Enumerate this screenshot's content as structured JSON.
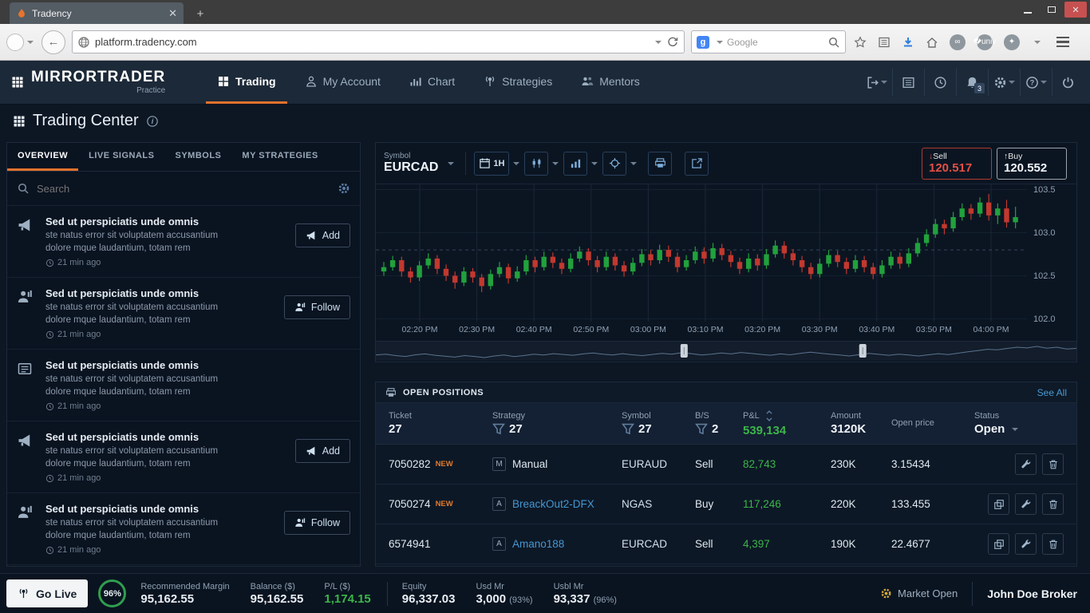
{
  "colors": {
    "accent_orange": "#e0722d",
    "green": "#3cb54a",
    "red": "#d9453a",
    "link_blue": "#4a9ad4",
    "candle_up": "#21a13c",
    "candle_down": "#c2382e"
  },
  "browser": {
    "tab_title": "Tradency",
    "url": "platform.tradency.com",
    "search_engine": "Google"
  },
  "app_header": {
    "logo": "MIRRORTRADER",
    "logo_sub": "Practice",
    "nav": [
      {
        "label": "Trading",
        "icon": "grid",
        "active": true
      },
      {
        "label": "My Account",
        "icon": "person",
        "active": false
      },
      {
        "label": "Chart",
        "icon": "chartbars",
        "active": false
      },
      {
        "label": "Strategies",
        "icon": "antenna",
        "active": false
      },
      {
        "label": "Mentors",
        "icon": "persons",
        "active": false
      }
    ],
    "notification_count": "3"
  },
  "page": {
    "title": "Trading Center"
  },
  "sidebar": {
    "tabs": [
      {
        "label": "OVERVIEW",
        "active": true
      },
      {
        "label": "LIVE SIGNALS",
        "active": false
      },
      {
        "label": "SYMBOLS",
        "active": false
      },
      {
        "label": "MY STRATEGIES",
        "active": false
      }
    ],
    "search_placeholder": "Search",
    "cards": [
      {
        "icon": "megaphone",
        "title": "Sed ut perspiciatis unde omnis",
        "desc": "ste natus error sit voluptatem accusantium dolore mque laudantium, totam rem",
        "time": "21 min ago",
        "action": "Add",
        "action_icon": "megaphone"
      },
      {
        "icon": "personchart",
        "title": "Sed ut perspiciatis unde omnis",
        "desc": "ste natus error sit voluptatem accusantium dolore mque laudantium, totam rem",
        "time": "21 min ago",
        "action": "Follow",
        "action_icon": "personchart"
      },
      {
        "icon": "news",
        "title": "Sed ut perspiciatis unde omnis",
        "desc": "ste natus error sit voluptatem accusantium dolore mque laudantium, totam rem",
        "time": "21 min ago",
        "action": "",
        "action_icon": ""
      },
      {
        "icon": "megaphone",
        "title": "Sed ut perspiciatis unde omnis",
        "desc": "ste natus error sit voluptatem accusantium dolore mque laudantium, totam rem",
        "time": "21 min ago",
        "action": "Add",
        "action_icon": "megaphone"
      },
      {
        "icon": "personchart",
        "title": "Sed ut perspiciatis unde omnis",
        "desc": "ste natus error sit voluptatem accusantium dolore mque laudantium, totam rem",
        "time": "21 min ago",
        "action": "Follow",
        "action_icon": "personchart"
      }
    ]
  },
  "chart": {
    "symbol_label": "Symbol",
    "symbol": "EURCAD",
    "timeframe": "1H",
    "sell_label": "Sell",
    "sell_price": "120.517",
    "buy_label": "Buy",
    "buy_price": "120.552"
  },
  "chart_data": {
    "type": "candlestick",
    "title": "EURCAD 1H intraday candles",
    "x_labels": [
      "02:20 PM",
      "02:30 PM",
      "02:40 PM",
      "02:50 PM",
      "03:00 PM",
      "03:10 PM",
      "03:20 PM",
      "03:30 PM",
      "03:40 PM",
      "03:50 PM",
      "04:00 PM"
    ],
    "y_ticks": [
      103.5,
      103.0,
      102.5,
      102.0
    ],
    "ylim": [
      101.8,
      103.6
    ],
    "dashed_level": 102.8,
    "up_color": "#21a13c",
    "down_color": "#c2382e",
    "candles": [
      [
        102.55,
        102.66,
        102.5,
        102.6
      ],
      [
        102.6,
        102.73,
        102.56,
        102.68
      ],
      [
        102.68,
        102.72,
        102.49,
        102.55
      ],
      [
        102.55,
        102.6,
        102.42,
        102.48
      ],
      [
        102.48,
        102.67,
        102.44,
        102.62
      ],
      [
        102.62,
        102.76,
        102.58,
        102.7
      ],
      [
        102.7,
        102.74,
        102.52,
        102.58
      ],
      [
        102.58,
        102.63,
        102.44,
        102.5
      ],
      [
        102.5,
        102.55,
        102.35,
        102.42
      ],
      [
        102.42,
        102.6,
        102.38,
        102.55
      ],
      [
        102.55,
        102.59,
        102.42,
        102.48
      ],
      [
        102.48,
        102.52,
        102.31,
        102.38
      ],
      [
        102.38,
        102.57,
        102.34,
        102.52
      ],
      [
        102.52,
        102.66,
        102.48,
        102.6
      ],
      [
        102.6,
        102.64,
        102.41,
        102.47
      ],
      [
        102.47,
        102.61,
        102.43,
        102.55
      ],
      [
        102.55,
        102.74,
        102.51,
        102.68
      ],
      [
        102.68,
        102.72,
        102.54,
        102.6
      ],
      [
        102.6,
        102.78,
        102.56,
        102.72
      ],
      [
        102.72,
        102.77,
        102.59,
        102.65
      ],
      [
        102.65,
        102.7,
        102.52,
        102.58
      ],
      [
        102.58,
        102.76,
        102.54,
        102.7
      ],
      [
        102.7,
        102.84,
        102.66,
        102.78
      ],
      [
        102.78,
        102.82,
        102.62,
        102.68
      ],
      [
        102.68,
        102.73,
        102.54,
        102.6
      ],
      [
        102.6,
        102.78,
        102.56,
        102.72
      ],
      [
        102.72,
        102.76,
        102.56,
        102.62
      ],
      [
        102.62,
        102.67,
        102.49,
        102.55
      ],
      [
        102.55,
        102.71,
        102.51,
        102.65
      ],
      [
        102.65,
        102.81,
        102.61,
        102.75
      ],
      [
        102.75,
        102.8,
        102.62,
        102.68
      ],
      [
        102.68,
        102.86,
        102.64,
        102.8
      ],
      [
        102.8,
        102.85,
        102.66,
        102.72
      ],
      [
        102.72,
        102.77,
        102.54,
        102.6
      ],
      [
        102.6,
        102.74,
        102.56,
        102.68
      ],
      [
        102.68,
        102.84,
        102.64,
        102.78
      ],
      [
        102.78,
        102.83,
        102.64,
        102.7
      ],
      [
        102.7,
        102.88,
        102.66,
        102.82
      ],
      [
        102.82,
        102.87,
        102.68,
        102.74
      ],
      [
        102.74,
        102.79,
        102.6,
        102.66
      ],
      [
        102.66,
        102.71,
        102.52,
        102.58
      ],
      [
        102.58,
        102.76,
        102.54,
        102.7
      ],
      [
        102.7,
        102.75,
        102.56,
        102.62
      ],
      [
        102.62,
        102.81,
        102.58,
        102.75
      ],
      [
        102.75,
        102.91,
        102.71,
        102.85
      ],
      [
        102.85,
        102.9,
        102.7,
        102.76
      ],
      [
        102.76,
        102.81,
        102.62,
        102.68
      ],
      [
        102.68,
        102.73,
        102.54,
        102.6
      ],
      [
        102.6,
        102.65,
        102.46,
        102.52
      ],
      [
        102.52,
        102.7,
        102.48,
        102.64
      ],
      [
        102.64,
        102.8,
        102.6,
        102.74
      ],
      [
        102.74,
        102.79,
        102.6,
        102.66
      ],
      [
        102.66,
        102.71,
        102.52,
        102.58
      ],
      [
        102.58,
        102.74,
        102.54,
        102.68
      ],
      [
        102.68,
        102.73,
        102.54,
        102.6
      ],
      [
        102.6,
        102.65,
        102.46,
        102.52
      ],
      [
        102.52,
        102.68,
        102.48,
        102.62
      ],
      [
        102.62,
        102.78,
        102.58,
        102.72
      ],
      [
        102.72,
        102.77,
        102.58,
        102.64
      ],
      [
        102.64,
        102.82,
        102.6,
        102.76
      ],
      [
        102.76,
        102.94,
        102.72,
        102.88
      ],
      [
        102.88,
        103.04,
        102.84,
        102.98
      ],
      [
        102.98,
        103.16,
        102.94,
        103.1
      ],
      [
        103.1,
        103.15,
        102.98,
        103.05
      ],
      [
        103.05,
        103.24,
        103.01,
        103.18
      ],
      [
        103.18,
        103.34,
        103.14,
        103.28
      ],
      [
        103.28,
        103.33,
        103.15,
        103.22
      ],
      [
        103.22,
        103.41,
        103.18,
        103.35
      ],
      [
        103.35,
        103.45,
        103.14,
        103.2
      ],
      [
        103.2,
        103.34,
        103.1,
        103.28
      ],
      [
        103.28,
        103.38,
        103.06,
        103.12
      ],
      [
        103.12,
        103.3,
        103.05,
        103.18
      ]
    ],
    "navigator_handles_pct": [
      0.44,
      0.695
    ]
  },
  "positions": {
    "title": "OPEN POSITIONS",
    "see_all": "See All",
    "new_label": "NEW",
    "columns": [
      {
        "label": "Ticket",
        "value": "27",
        "filter": false,
        "sort": false,
        "green": false,
        "dropdown": false
      },
      {
        "label": "Strategy",
        "value": "27",
        "filter": true,
        "sort": false,
        "green": false,
        "dropdown": false
      },
      {
        "label": "Symbol",
        "value": "27",
        "filter": true,
        "sort": false,
        "green": false,
        "dropdown": false
      },
      {
        "label": "B/S",
        "value": "2",
        "filter": true,
        "sort": false,
        "green": false,
        "dropdown": false
      },
      {
        "label": "P&L",
        "value": "539,134",
        "filter": false,
        "sort": true,
        "green": true,
        "dropdown": false
      },
      {
        "label": "Amount",
        "value": "3120K",
        "filter": false,
        "sort": false,
        "green": false,
        "dropdown": false
      },
      {
        "label": "Open price",
        "value": "",
        "filter": false,
        "sort": false,
        "green": false,
        "dropdown": false
      },
      {
        "label": "Status",
        "value": "Open",
        "filter": false,
        "sort": false,
        "green": false,
        "dropdown": true
      }
    ],
    "rows": [
      {
        "ticket": "7050282",
        "new": true,
        "badge": "M",
        "strategy": "Manual",
        "strategy_link": false,
        "symbol": "EURAUD",
        "side": "Sell",
        "pnl": "82,743",
        "amount": "230K",
        "open_price": "3.15434",
        "actions": [
          "edit",
          "delete"
        ]
      },
      {
        "ticket": "7050274",
        "new": true,
        "badge": "A",
        "strategy": "BreackOut2-DFX",
        "strategy_link": true,
        "symbol": "NGAS",
        "side": "Buy",
        "pnl": "117,246",
        "amount": "220K",
        "open_price": "133.455",
        "actions": [
          "copy",
          "edit",
          "delete"
        ]
      },
      {
        "ticket": "6574941",
        "new": false,
        "badge": "A",
        "strategy": "Amano188",
        "strategy_link": true,
        "symbol": "EURCAD",
        "side": "Sell",
        "pnl": "4,397",
        "amount": "190K",
        "open_price": "22.4677",
        "actions": [
          "copy",
          "edit",
          "delete"
        ]
      }
    ]
  },
  "footer": {
    "go_live": "Go Live",
    "margin_pct": "96%",
    "stats_left": [
      {
        "label": "Recommended Margin",
        "value": "95,162.55",
        "green": false,
        "suffix": ""
      },
      {
        "label": "Balance ($)",
        "value": "95,162.55",
        "green": false,
        "suffix": ""
      },
      {
        "label": "P/L ($)",
        "value": "1,174.15",
        "green": true,
        "suffix": ""
      }
    ],
    "stats_right": [
      {
        "label": "Equity",
        "value": "96,337.03",
        "green": false,
        "suffix": ""
      },
      {
        "label": "Usd Mr",
        "value": "3,000",
        "green": false,
        "suffix": "(93%)"
      },
      {
        "label": "Usbl Mr",
        "value": "93,337",
        "green": false,
        "suffix": "(96%)"
      }
    ],
    "market_status": "Market Open",
    "broker": "John Doe Broker"
  }
}
